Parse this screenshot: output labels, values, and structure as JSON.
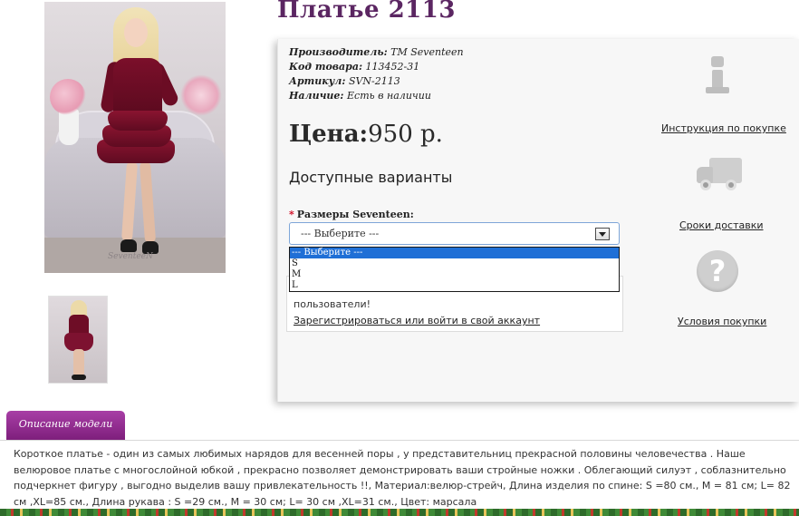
{
  "product": {
    "title": "Платье 2113",
    "meta": [
      {
        "label": "Производитель:",
        "value": "TM Seventeen"
      },
      {
        "label": "Код товара:",
        "value": "113452-31"
      },
      {
        "label": "Артикул:",
        "value": "SVN-2113"
      },
      {
        "label": "Наличие:",
        "value": "Есть в наличии"
      }
    ],
    "price_label": "Цена:",
    "price_value": "950 р.",
    "variants_heading": "Доступные варианты",
    "size_label": "Размеры Seventeen:",
    "required_mark": "*",
    "select_value": "--- Выберите ---",
    "options": [
      "--- Выберите ---",
      "S",
      "M",
      "L"
    ],
    "photo_watermark": "SeventeeN"
  },
  "register": {
    "text": "пользователи!",
    "link": "Зарегистрироваться или войти в свой аккаунт"
  },
  "side": {
    "instruction": "Инструкция по покупке",
    "delivery": "Сроки доставки",
    "conditions": "Условия покупки",
    "help_glyph": "?"
  },
  "description": {
    "tab": "Описание модели",
    "text": "Короткое платье - один из самых любимых нарядов для весенней поры , у представительниц прекрасной половины человечества . Наше велюровое платье с многослойной юбкой , прекрасно позволяет демонстрировать ваши стройные ножки . Облегающий силуэт , соблазнительно подчеркнет фигуру , выгодно выделив вашу привлекательность !!, Материал:велюр-стрейч, Длина изделия по спине: S =80 см., M = 81 см; L= 82 см ,XL=85 см., Длина рукава : S =29 см., M = 30 см; L= 30 см ,XL=31 см., Цвет: марсала"
  },
  "colors": {
    "title": "#5b2662",
    "tab": "#8e2c8c",
    "option_highlight": "#1f6fd6",
    "required": "#d0021b"
  }
}
